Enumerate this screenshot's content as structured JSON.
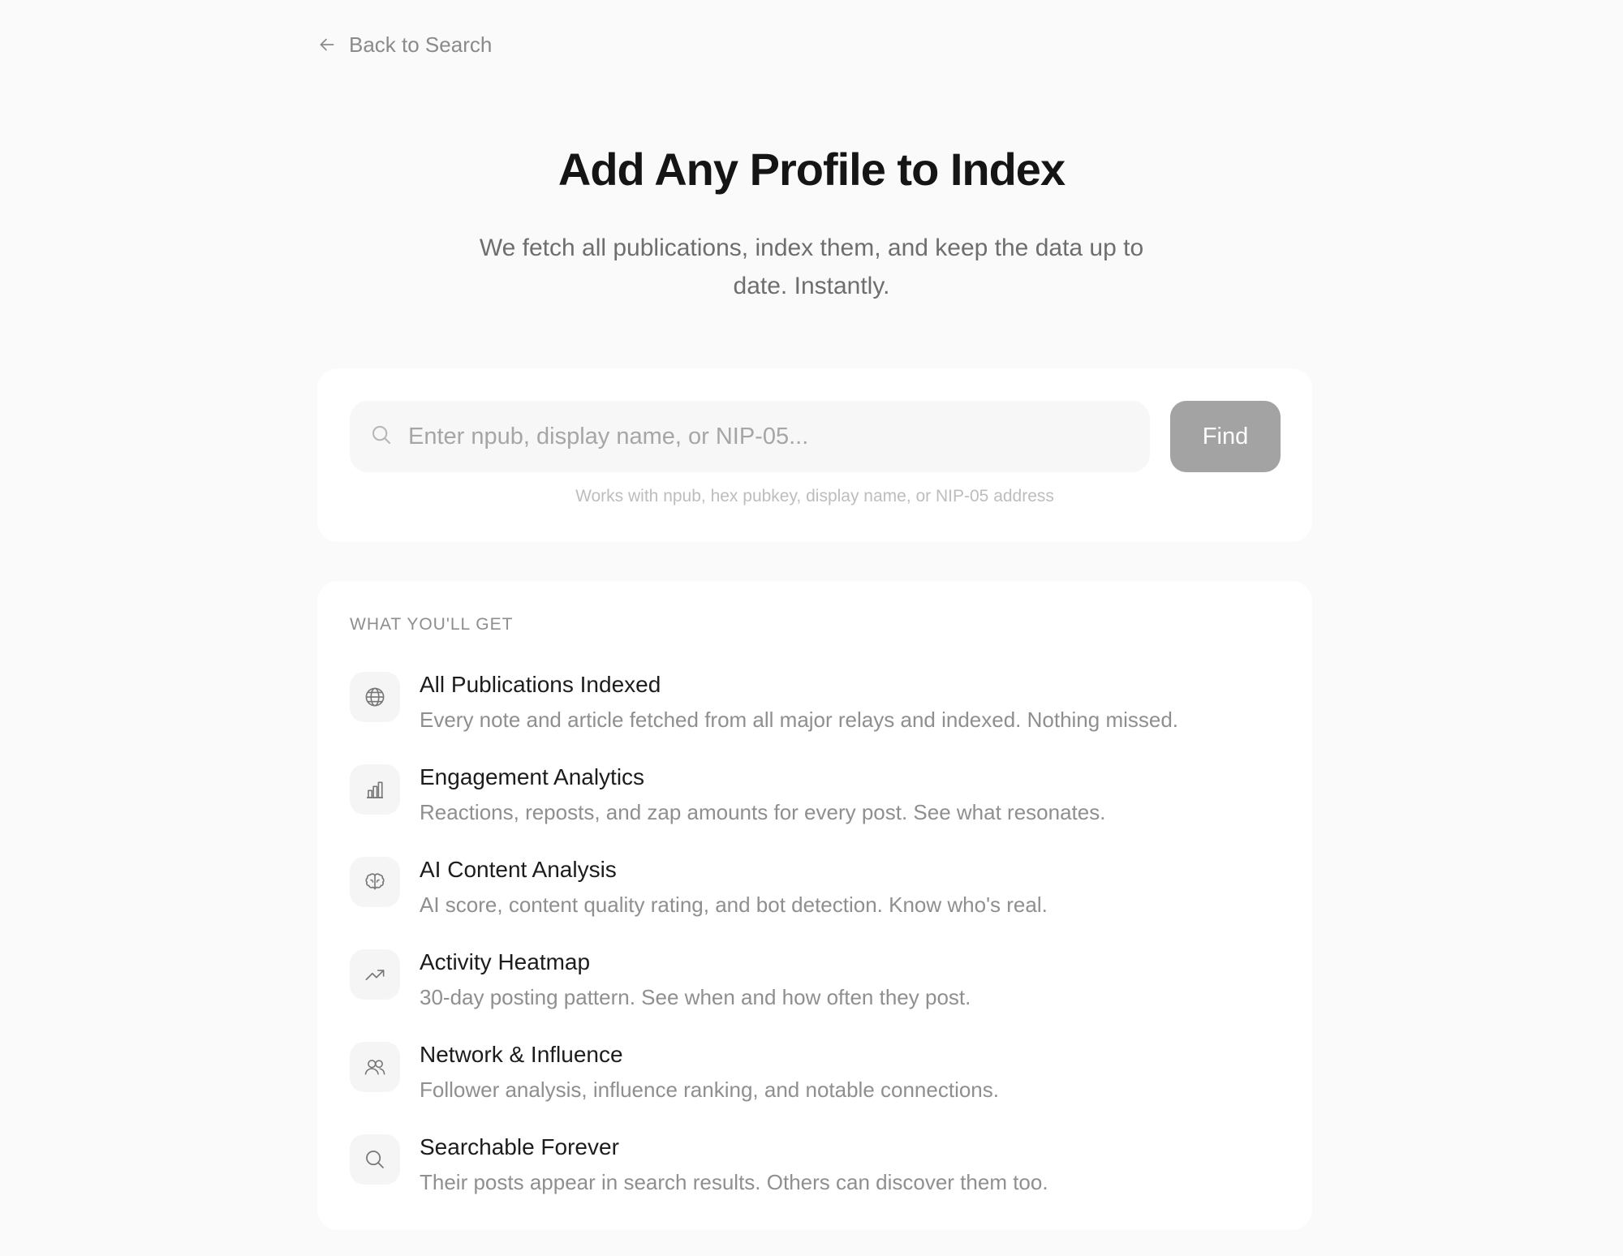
{
  "nav": {
    "back_label": "Back to Search",
    "back_icon": "arrow-left-icon"
  },
  "hero": {
    "title": "Add Any Profile to Index",
    "subtitle": "We fetch all publications, index them, and keep the data up to date. Instantly."
  },
  "search": {
    "icon": "search-icon",
    "placeholder": "Enter npub, display name, or NIP-05...",
    "value": "",
    "button_label": "Find",
    "hint": "Works with npub, hex pubkey, display name, or NIP-05 address"
  },
  "features": {
    "section_label": "WHAT YOU'LL GET",
    "items": [
      {
        "icon": "globe-icon",
        "title": "All Publications Indexed",
        "description": "Every note and article fetched from all major relays and indexed. Nothing missed."
      },
      {
        "icon": "bar-chart-icon",
        "title": "Engagement Analytics",
        "description": "Reactions, reposts, and zap amounts for every post. See what resonates."
      },
      {
        "icon": "brain-icon",
        "title": "AI Content Analysis",
        "description": "AI score, content quality rating, and bot detection. Know who's real."
      },
      {
        "icon": "trending-up-icon",
        "title": "Activity Heatmap",
        "description": "30-day posting pattern. See when and how often they post."
      },
      {
        "icon": "users-icon",
        "title": "Network & Influence",
        "description": "Follower analysis, influence ranking, and notable connections."
      },
      {
        "icon": "search-icon",
        "title": "Searchable Forever",
        "description": "Their posts appear in search results. Others can discover them too."
      }
    ]
  },
  "colors": {
    "background": "#fafafa",
    "card": "#ffffff",
    "button_disabled": "#a3a3a3",
    "text_primary": "#151515",
    "text_muted": "#8f8f8f"
  }
}
